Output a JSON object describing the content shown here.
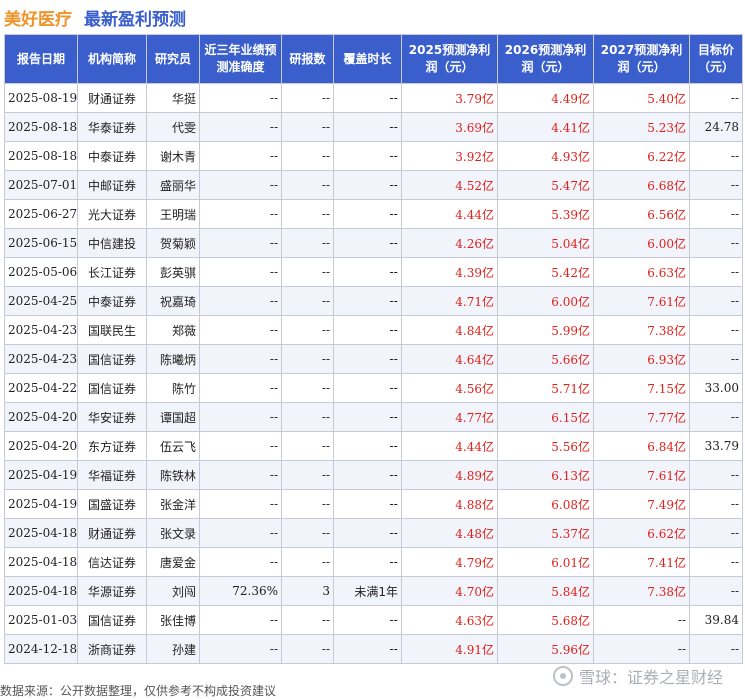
{
  "header": {
    "company": "美好医疗",
    "subtitle": "最新盈利预测"
  },
  "columns": [
    "报告日期",
    "机构简称",
    "研究员",
    "近三年业绩预测准确度",
    "研报数",
    "覆盖时长",
    "2025预测净利润（元）",
    "2026预测净利润（元）",
    "2027预测净利润（元）",
    "目标价（元）"
  ],
  "rows": [
    [
      "2025-08-19",
      "财通证券",
      "华挺",
      "--",
      "--",
      "--",
      "3.79亿",
      "4.49亿",
      "5.40亿",
      "--"
    ],
    [
      "2025-08-18",
      "华泰证券",
      "代雯",
      "--",
      "--",
      "--",
      "3.69亿",
      "4.41亿",
      "5.23亿",
      "24.78"
    ],
    [
      "2025-08-18",
      "中泰证券",
      "谢木青",
      "--",
      "--",
      "--",
      "3.92亿",
      "4.93亿",
      "6.22亿",
      "--"
    ],
    [
      "2025-07-01",
      "中邮证券",
      "盛丽华",
      "--",
      "--",
      "--",
      "4.52亿",
      "5.47亿",
      "6.68亿",
      "--"
    ],
    [
      "2025-06-27",
      "光大证券",
      "王明瑞",
      "--",
      "--",
      "--",
      "4.44亿",
      "5.39亿",
      "6.56亿",
      "--"
    ],
    [
      "2025-06-15",
      "中信建投",
      "贺菊颖",
      "--",
      "--",
      "--",
      "4.26亿",
      "5.04亿",
      "6.00亿",
      "--"
    ],
    [
      "2025-05-06",
      "长江证券",
      "彭英骐",
      "--",
      "--",
      "--",
      "4.39亿",
      "5.42亿",
      "6.63亿",
      "--"
    ],
    [
      "2025-04-25",
      "中泰证券",
      "祝嘉琦",
      "--",
      "--",
      "--",
      "4.71亿",
      "6.00亿",
      "7.61亿",
      "--"
    ],
    [
      "2025-04-23",
      "国联民生",
      "郑薇",
      "--",
      "--",
      "--",
      "4.84亿",
      "5.99亿",
      "7.38亿",
      "--"
    ],
    [
      "2025-04-23",
      "国信证券",
      "陈曦炳",
      "--",
      "--",
      "--",
      "4.64亿",
      "5.66亿",
      "6.93亿",
      "--"
    ],
    [
      "2025-04-22",
      "国信证券",
      "陈竹",
      "--",
      "--",
      "--",
      "4.56亿",
      "5.71亿",
      "7.15亿",
      "33.00"
    ],
    [
      "2025-04-20",
      "华安证券",
      "谭国超",
      "--",
      "--",
      "--",
      "4.77亿",
      "6.15亿",
      "7.77亿",
      "--"
    ],
    [
      "2025-04-20",
      "东方证券",
      "伍云飞",
      "--",
      "--",
      "--",
      "4.44亿",
      "5.56亿",
      "6.84亿",
      "33.79"
    ],
    [
      "2025-04-19",
      "华福证券",
      "陈铁林",
      "--",
      "--",
      "--",
      "4.89亿",
      "6.13亿",
      "7.61亿",
      "--"
    ],
    [
      "2025-04-19",
      "国盛证券",
      "张金洋",
      "--",
      "--",
      "--",
      "4.88亿",
      "6.08亿",
      "7.49亿",
      "--"
    ],
    [
      "2025-04-18",
      "财通证券",
      "张文录",
      "--",
      "--",
      "--",
      "4.48亿",
      "5.37亿",
      "6.62亿",
      "--"
    ],
    [
      "2025-04-18",
      "信达证券",
      "唐爱金",
      "--",
      "--",
      "--",
      "4.79亿",
      "6.01亿",
      "7.41亿",
      "--"
    ],
    [
      "2025-04-18",
      "华源证券",
      "刘闯",
      "72.36%",
      "3",
      "未满1年",
      "4.70亿",
      "5.84亿",
      "7.38亿",
      "--"
    ],
    [
      "2025-01-03",
      "国信证券",
      "张佳博",
      "--",
      "--",
      "--",
      "4.63亿",
      "5.68亿",
      "--",
      "39.84"
    ],
    [
      "2024-12-18",
      "浙商证券",
      "孙建",
      "--",
      "--",
      "--",
      "4.91亿",
      "5.96亿",
      "--",
      "--"
    ]
  ],
  "footer": "数据来源：公开数据整理，仅供参考不构成投资建议",
  "brand": "雪球：证券之星财经",
  "colors": {
    "header_bg": "#3a5fcd",
    "accent": "#f0932b",
    "profit_red": "#e0211b"
  }
}
